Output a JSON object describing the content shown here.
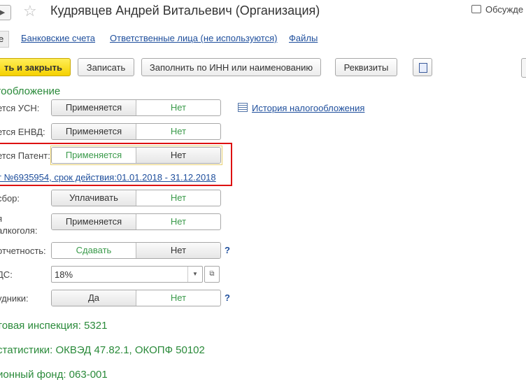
{
  "header": {
    "title": "Кудрявцев Андрей Витальевич (Организация)",
    "discuss_label": "Обсужде"
  },
  "tabs": {
    "active_label": "е",
    "links": [
      "Банковские счета",
      "Ответственные лица (не используются)",
      "Файлы"
    ]
  },
  "toolbar": {
    "save_close": "ть и закрыть",
    "save": "Записать",
    "fill": "Заполнить по ИНН или наименованию",
    "details": "Реквизиты"
  },
  "tax": {
    "section_title": "гообложение",
    "history_link": "История налогообложения",
    "rows": [
      {
        "label": "ется УСН:",
        "left": "Применяется",
        "right": "Нет",
        "selected": "right"
      },
      {
        "label": "ется ЕНВД:",
        "left": "Применяется",
        "right": "Нет",
        "selected": "right"
      },
      {
        "label": "ется Патент:",
        "left": "Применяется",
        "right": "Нет",
        "selected": "right"
      },
      {
        "label": "сбор:",
        "left": "Уплачивать",
        "right": "Нет",
        "selected": "right"
      },
      {
        "label1": "я",
        "label2": "алкоголя:",
        "left": "Применяется",
        "right": "Нет",
        "selected": "right"
      },
      {
        "label": "отчетность:",
        "left": "Сдавать",
        "right": "Нет",
        "selected": "right"
      }
    ],
    "patent_link": "т №6935954, срок действия:01.01.2018 - 31.12.2018",
    "vat_label": "ДС:",
    "vat_value": "18%",
    "employees_label": "удники:",
    "employees_left": "Да",
    "employees_right": "Нет",
    "help": "?"
  },
  "info": {
    "inspection": "товая инспекция: 5321",
    "statistics": "статистики: ОКВЭД 47.82.1, ОКОПФ 50102",
    "pension": "ионный фонд: 063-001"
  }
}
